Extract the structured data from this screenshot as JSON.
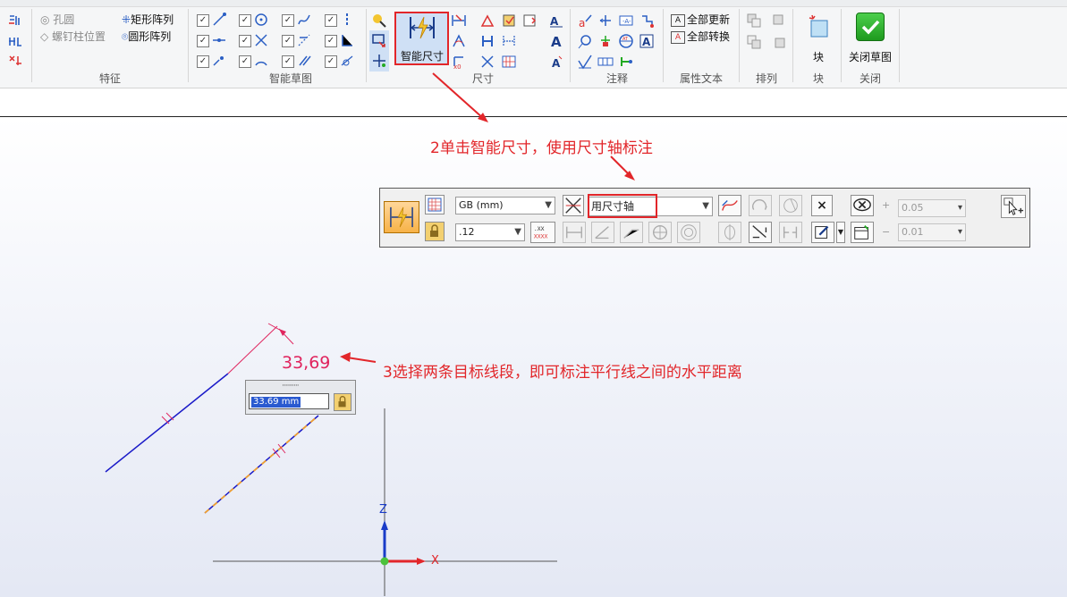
{
  "ribbon": {
    "feature_group": {
      "label": "特征",
      "hole": "孔圆",
      "bolt_position": "螺钉柱位置",
      "rect_array": "矩形阵列",
      "circ_array": "圆形阵列"
    },
    "sketch_group": {
      "label": "智能草图"
    },
    "dimension_group": {
      "label": "尺寸",
      "smart_dimension": "智能尺寸"
    },
    "annotation_group": {
      "label": "注释"
    },
    "property_text_group": {
      "label": "属性文本",
      "update_all": "全部更新",
      "convert_all": "全部转换"
    },
    "arrange_group": {
      "label": "排列"
    },
    "block_group": {
      "label": "块",
      "block": "块"
    },
    "close_group": {
      "label": "关闭",
      "close_sketch": "关闭草图"
    }
  },
  "annotations": {
    "step2": "2单击智能尺寸，使用尺寸轴标注",
    "step3": "3选择两条目标线段，即可标注平行线之间的水平距离"
  },
  "command_bar": {
    "standard": "GB (mm)",
    "precision": ".12",
    "dimension_mode": "用尺寸轴",
    "tol_plus_sign": "+",
    "tol_minus_sign": "−",
    "tol_upper": "0.05",
    "tol_lower": "0.01",
    "clear_symbol": "×"
  },
  "drawing": {
    "dimension_value": "33,69",
    "edit_value": "33.69 mm",
    "axis_z": "Z",
    "axis_x": "X"
  },
  "colors": {
    "accent_red": "#e2262a",
    "dimension_magenta": "#e0245e",
    "line_blue": "#1a1ac8",
    "selection_orange": "#f0a030"
  }
}
